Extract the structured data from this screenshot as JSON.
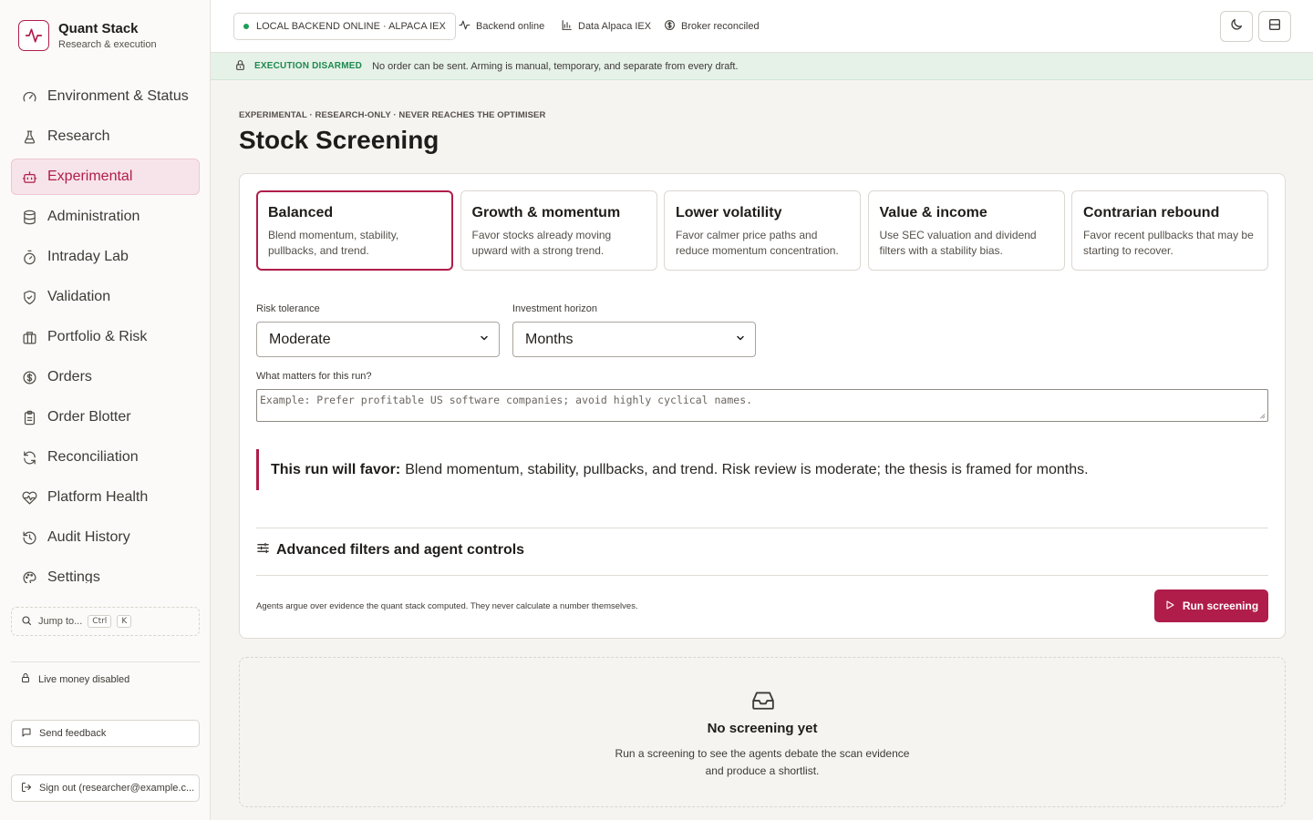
{
  "brand": {
    "name": "Quant Stack",
    "subtitle": "Research & execution"
  },
  "sidebar": {
    "items": [
      {
        "label": "Environment & Status",
        "icon": "gauge-icon"
      },
      {
        "label": "Research",
        "icon": "flask-icon"
      },
      {
        "label": "Experimental",
        "icon": "bot-icon",
        "active": true
      },
      {
        "label": "Administration",
        "icon": "database-icon"
      },
      {
        "label": "Intraday Lab",
        "icon": "timer-icon"
      },
      {
        "label": "Validation",
        "icon": "shield-check-icon"
      },
      {
        "label": "Portfolio & Risk",
        "icon": "briefcase-icon"
      },
      {
        "label": "Orders",
        "icon": "dollar-circle-icon"
      },
      {
        "label": "Order Blotter",
        "icon": "clipboard-icon"
      },
      {
        "label": "Reconciliation",
        "icon": "refresh-icon"
      },
      {
        "label": "Platform Health",
        "icon": "heart-pulse-icon"
      },
      {
        "label": "Audit History",
        "icon": "history-icon"
      },
      {
        "label": "Settings",
        "icon": "palette-icon"
      }
    ],
    "jump_label": "Jump to...",
    "jump_keys": [
      "Ctrl",
      "K"
    ],
    "live_money": "Live money disabled",
    "feedback": "Send feedback",
    "sign_out": "Sign out (researcher@example.c..."
  },
  "topbar": {
    "backend_pill": "LOCAL BACKEND ONLINE · ALPACA IEX",
    "statuses": [
      "Backend online",
      "Data Alpaca IEX",
      "Broker reconciled"
    ]
  },
  "banner": {
    "tag": "EXECUTION DISARMED",
    "message": "No order can be sent. Arming is manual, temporary, and separate from every draft."
  },
  "page": {
    "eyebrow": "EXPERIMENTAL · RESEARCH-ONLY · NEVER REACHES THE OPTIMISER",
    "title": "Stock Screening"
  },
  "presets": [
    {
      "title": "Balanced",
      "desc": "Blend momentum, stability, pullbacks, and trend.",
      "active": true
    },
    {
      "title": "Growth & momentum",
      "desc": "Favor stocks already moving upward with a strong trend."
    },
    {
      "title": "Lower volatility",
      "desc": "Favor calmer price paths and reduce momentum concentration."
    },
    {
      "title": "Value & income",
      "desc": "Use SEC valuation and dividend filters with a stability bias."
    },
    {
      "title": "Contrarian rebound",
      "desc": "Favor recent pullbacks that may be starting to recover."
    }
  ],
  "form": {
    "risk_label": "Risk tolerance",
    "risk_value": "Moderate",
    "horizon_label": "Investment horizon",
    "horizon_value": "Months",
    "notes_label": "What matters for this run?",
    "notes_placeholder": "Example: Prefer profitable US software companies; avoid highly cyclical names."
  },
  "summary": {
    "lead": "This run will favor:",
    "text": "Blend momentum, stability, pullbacks, and trend. Risk review is moderate; the thesis is framed for months."
  },
  "advanced_label": "Advanced filters and agent controls",
  "footer_note": "Agents argue over evidence the quant stack computed. They never calculate a number themselves.",
  "run_button": "Run screening",
  "empty_state": {
    "title": "No screening yet",
    "line1": "Run a screening to see the agents debate the scan evidence",
    "line2": "and produce a shortlist."
  },
  "colors": {
    "accent": "#b01d4a",
    "success": "#1e8a4f",
    "banner_bg": "#e6f1e8"
  }
}
